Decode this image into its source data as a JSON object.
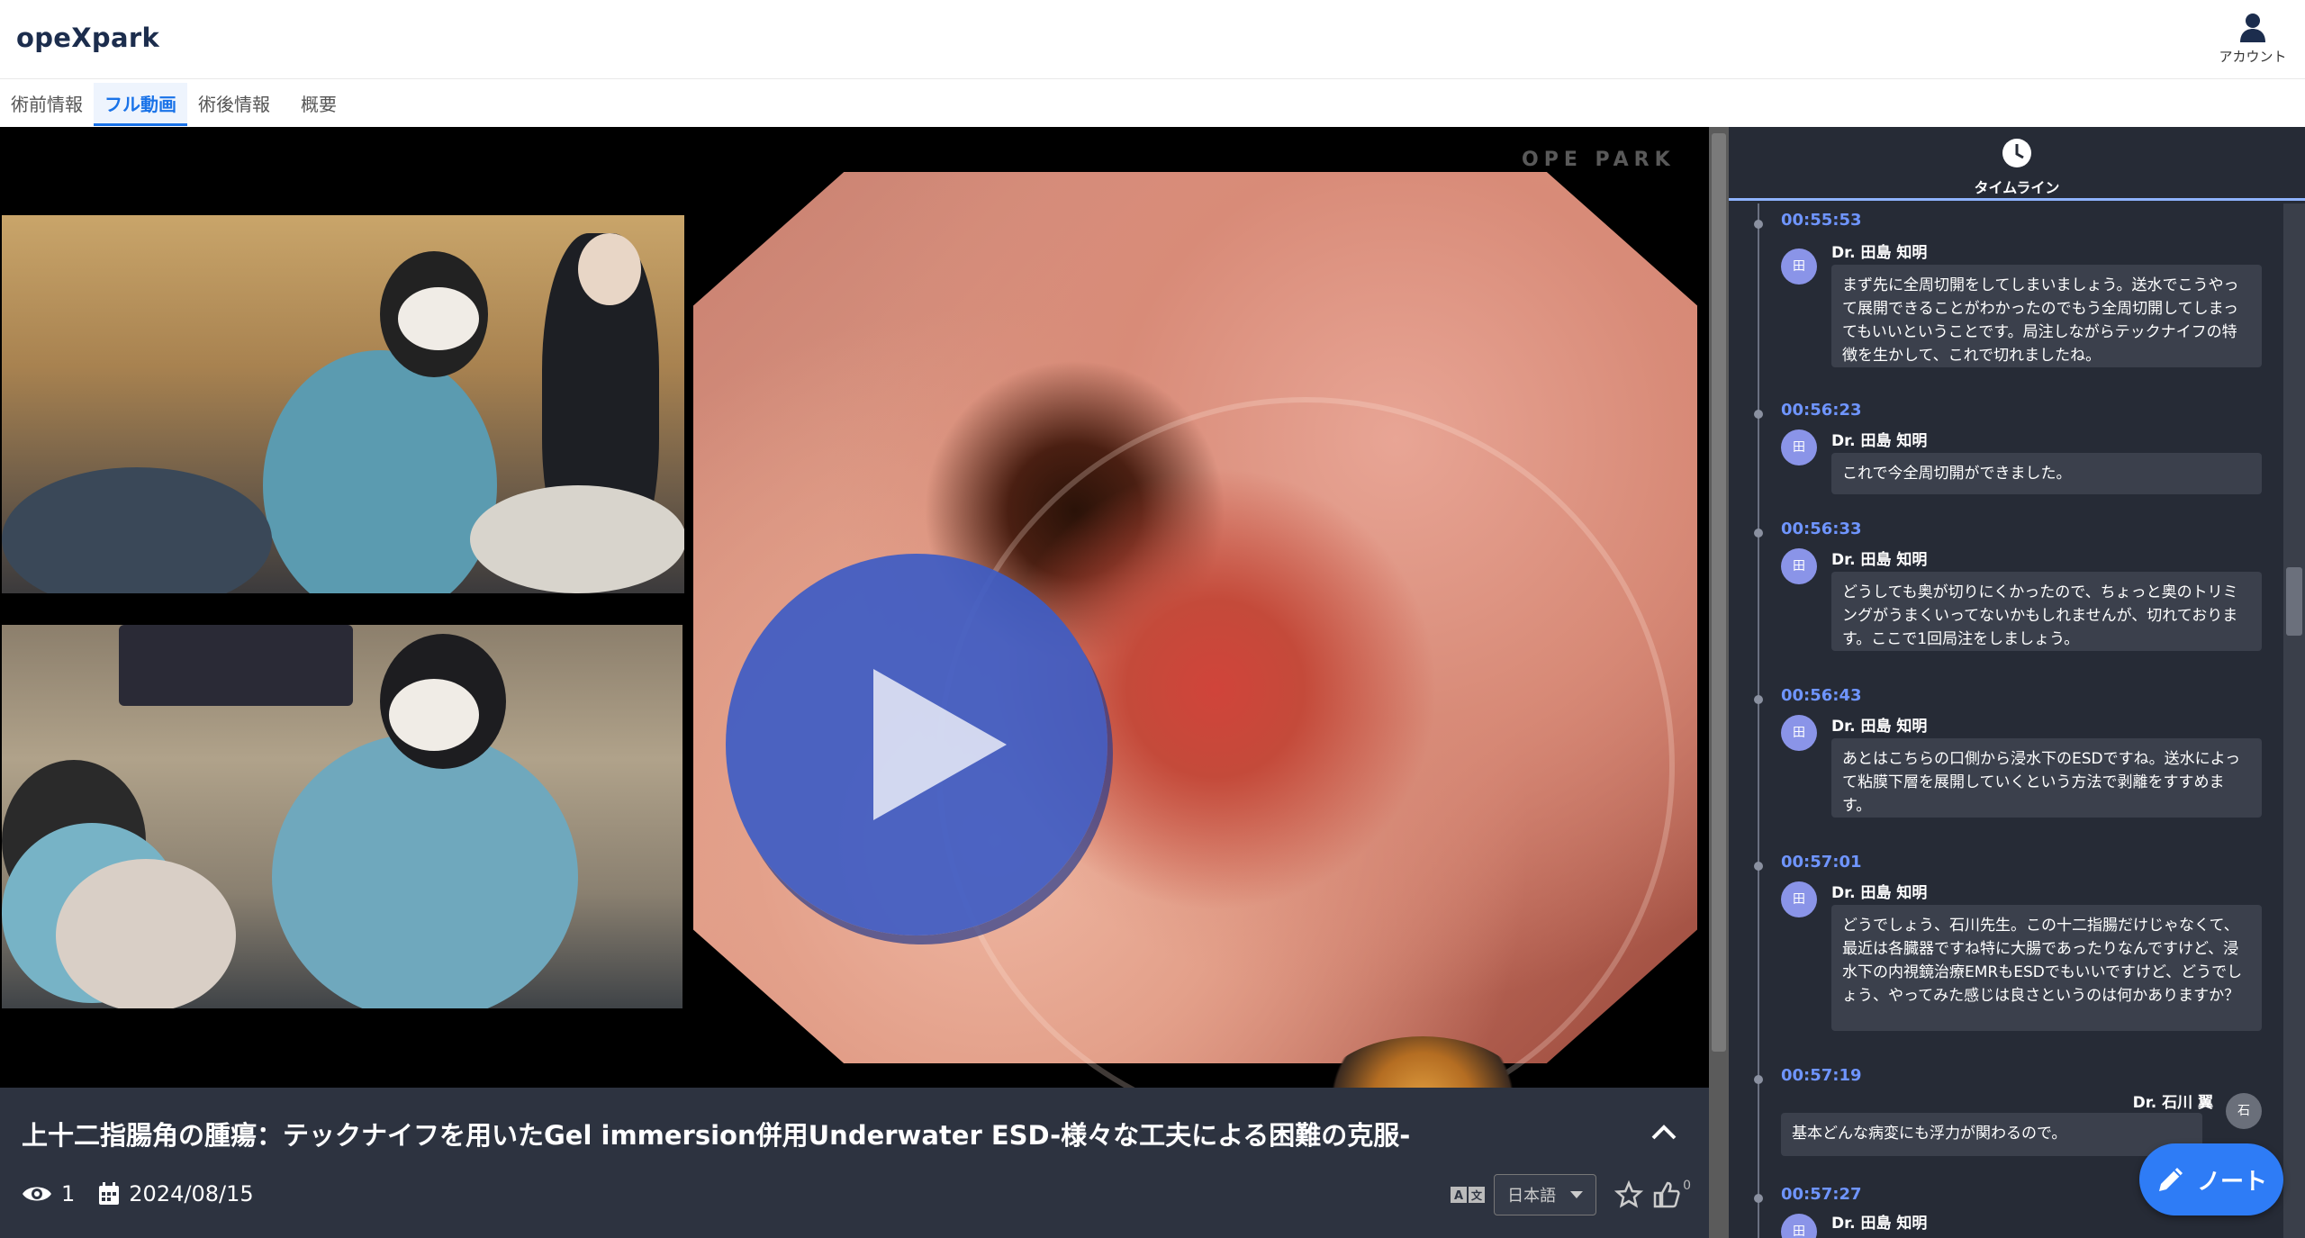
{
  "app": {
    "logo": "opeXpark"
  },
  "account": {
    "label": "アカウント",
    "icon": "person-icon"
  },
  "tabs": [
    {
      "label": "術前情報",
      "active": false
    },
    {
      "label": "フル動画",
      "active": true
    },
    {
      "label": "術後情報",
      "active": false
    },
    {
      "label": "概要",
      "active": false
    }
  ],
  "video": {
    "watermark": "OPE  PARK",
    "title": "上十二指腸角の腫瘍：テックナイフを用いたGel immersion併用Underwater ESD-様々な工夫による困難の克服-",
    "views": "1",
    "date": "2024/08/15",
    "language": "日本語",
    "like_count": "0"
  },
  "panel": {
    "header_label": "タイムライン",
    "entries": [
      {
        "time": "00:55:53",
        "author": "Dr. 田島 知明",
        "avatar": "田",
        "side": "left",
        "text": "まず先に全周切開をしてしまいましょう。送水でこうやって展開できることがわかったのでもう全周切開してしまってもいいということです。局注しながらテックナイフの特徴を生かして、これで切れましたね。"
      },
      {
        "time": "00:56:23",
        "author": "Dr. 田島 知明",
        "avatar": "田",
        "side": "left",
        "text": "これで今全周切開ができました。"
      },
      {
        "time": "00:56:33",
        "author": "Dr. 田島 知明",
        "avatar": "田",
        "side": "left",
        "text": "どうしても奥が切りにくかったので、ちょっと奥のトリミングがうまくいってないかもしれませんが、切れております。ここで1回局注をしましょう。"
      },
      {
        "time": "00:56:43",
        "author": "Dr. 田島 知明",
        "avatar": "田",
        "side": "left",
        "text": "あとはこちらの口側から浸水下のESDですね。送水によって粘膜下層を展開していくという方法で剥離をすすめます。"
      },
      {
        "time": "00:57:01",
        "author": "Dr. 田島 知明",
        "avatar": "田",
        "side": "left",
        "text": "どうでしょう、石川先生。この十二指腸だけじゃなくて、最近は各臓器ですね特に大腸であったりなんですけど、浸水下の内視鏡治療EMRもESDでもいいですけど、どうでしょう、やってみた感じは良さというのは何かありますか？"
      },
      {
        "time": "00:57:19",
        "author": "Dr. 石川 翼",
        "avatar": "石",
        "side": "right",
        "text": "基本どんな病変にも浮力が関わるので。"
      },
      {
        "time": "00:57:27",
        "author": "Dr. 田島 知明",
        "avatar": "田",
        "side": "left",
        "text": ""
      }
    ]
  },
  "note_button": {
    "label": "ノート",
    "icon": "pencil-icon"
  },
  "colors": {
    "accent": "#1a73e8",
    "panel_bg": "#262b36",
    "time": "#6f95ff",
    "play": "#3e5cc4",
    "note": "#2e7cf6"
  }
}
